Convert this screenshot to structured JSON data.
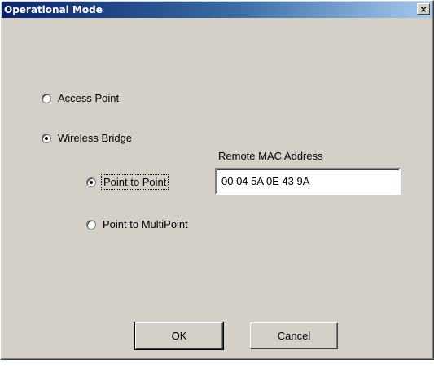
{
  "window": {
    "title": "Operational Mode",
    "close_label": "×"
  },
  "mode": {
    "access_point": {
      "label": "Access Point",
      "selected": false
    },
    "wireless_bridge": {
      "label": "Wireless Bridge",
      "selected": true
    }
  },
  "bridge": {
    "point_to_point": {
      "label": "Point to Point",
      "selected": true
    },
    "point_to_multipoint": {
      "label": "Point to MultiPoint",
      "selected": false
    },
    "remote_mac_label": "Remote MAC Address",
    "remote_mac_value": "00 04 5A 0E 43 9A"
  },
  "buttons": {
    "ok_label": "OK",
    "cancel_label": "Cancel"
  }
}
